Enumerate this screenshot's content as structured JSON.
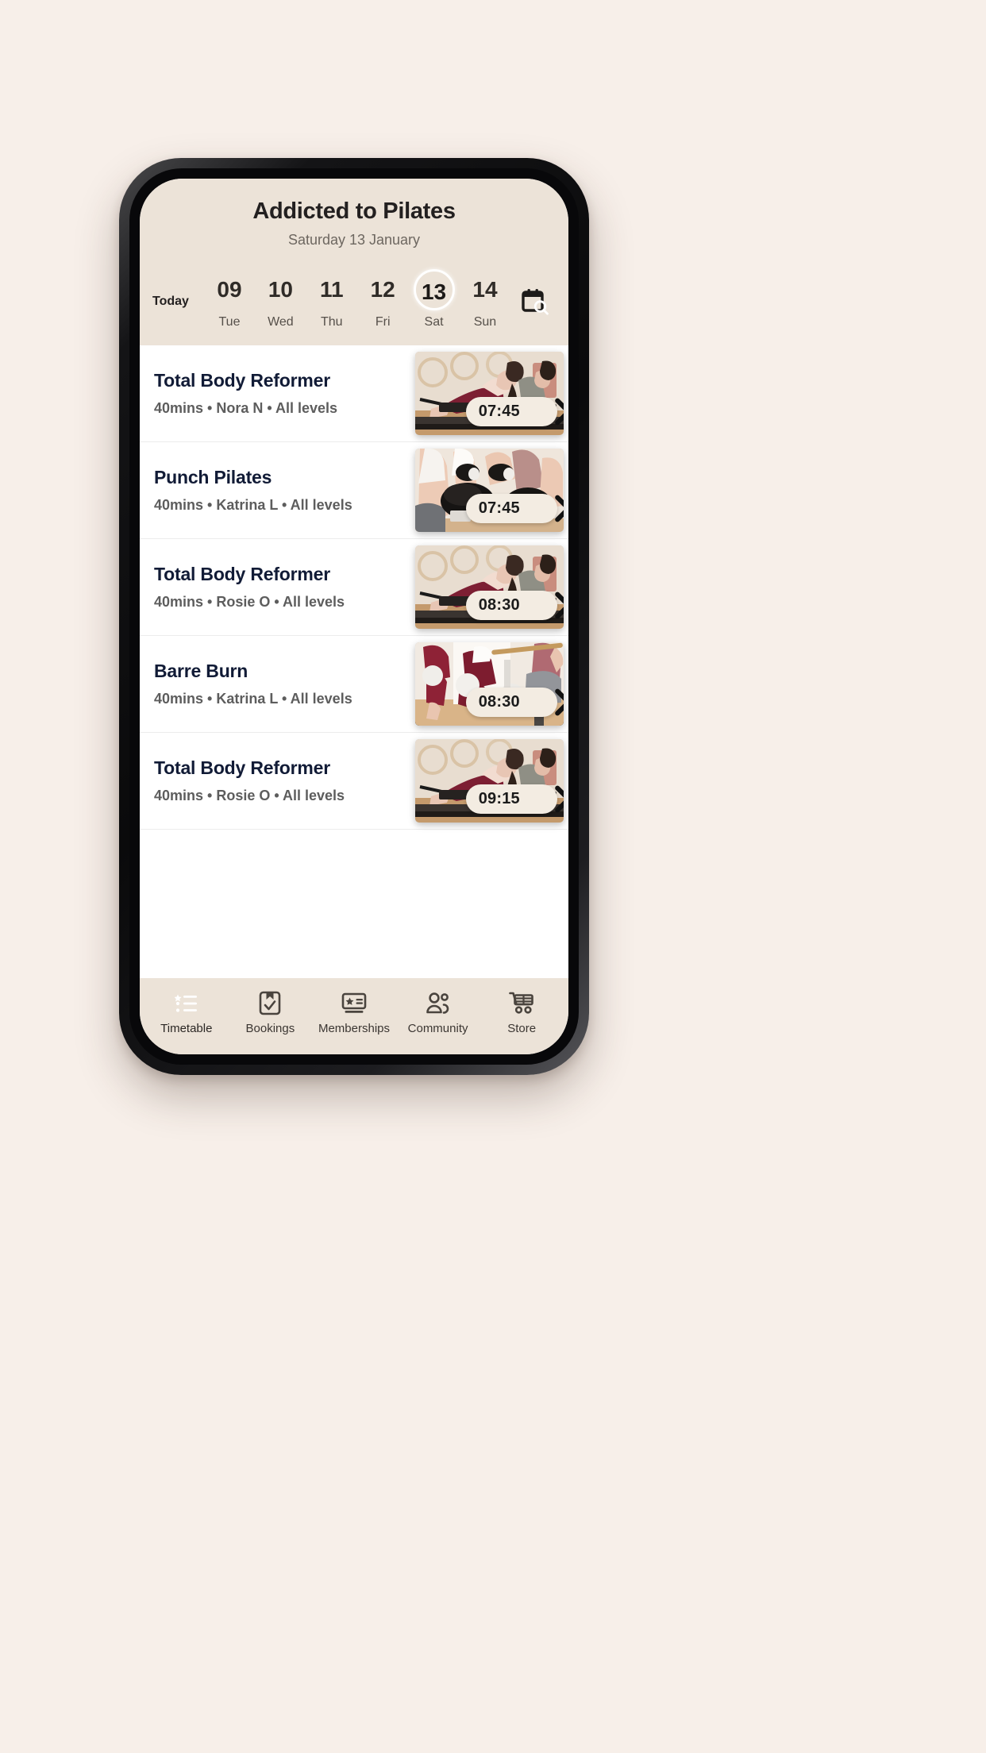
{
  "app": {
    "title": "Addicted to Pilates",
    "date_subtitle": "Saturday 13 January"
  },
  "date_strip": {
    "today_label": "Today",
    "calendar_search_icon": "calendar-search-icon",
    "days": [
      {
        "num": "09",
        "name": "Tue",
        "selected": false
      },
      {
        "num": "10",
        "name": "Wed",
        "selected": false
      },
      {
        "num": "11",
        "name": "Thu",
        "selected": false
      },
      {
        "num": "12",
        "name": "Fri",
        "selected": false
      },
      {
        "num": "13",
        "name": "Sat",
        "selected": true
      },
      {
        "num": "14",
        "name": "Sun",
        "selected": false
      }
    ]
  },
  "classes": [
    {
      "title": "Total Body Reformer",
      "meta": "40mins • Nora N • All levels",
      "duration": "40mins",
      "instructor": "Nora N",
      "level": "All levels",
      "time": "07:45",
      "thumb": "reformer-class-photo"
    },
    {
      "title": "Punch Pilates",
      "meta": "40mins • Katrina L • All levels",
      "duration": "40mins",
      "instructor": "Katrina L",
      "level": "All levels",
      "time": "07:45",
      "thumb": "boxing-gloves-photo"
    },
    {
      "title": "Total Body Reformer",
      "meta": "40mins • Rosie O • All levels",
      "duration": "40mins",
      "instructor": "Rosie O",
      "level": "All levels",
      "time": "08:30",
      "thumb": "reformer-class-photo"
    },
    {
      "title": "Barre Burn",
      "meta": "40mins • Katrina L • All levels",
      "duration": "40mins",
      "instructor": "Katrina L",
      "level": "All levels",
      "time": "08:30",
      "thumb": "barre-ball-photo"
    },
    {
      "title": "Total Body Reformer",
      "meta": "40mins • Rosie O • All levels",
      "duration": "40mins",
      "instructor": "Rosie O",
      "level": "All levels",
      "time": "09:15",
      "thumb": "reformer-class-photo"
    }
  ],
  "bottom_nav": {
    "items": [
      {
        "label": "Timetable",
        "icon": "list-star-icon",
        "active": true
      },
      {
        "label": "Bookings",
        "icon": "clipboard-check-icon",
        "active": false
      },
      {
        "label": "Memberships",
        "icon": "card-star-icon",
        "active": false
      },
      {
        "label": "Community",
        "icon": "people-icon",
        "active": false
      },
      {
        "label": "Store",
        "icon": "shopping-cart-icon",
        "active": false
      }
    ]
  },
  "colors": {
    "page_background": "#f7efe9",
    "header_background": "#ece3d8",
    "card_background": "#ffffff",
    "title_navy": "#111b36",
    "meta_gray": "#5d5d5d",
    "pill_cream": "#f3ece2",
    "nav_icon": "#4a443e"
  }
}
